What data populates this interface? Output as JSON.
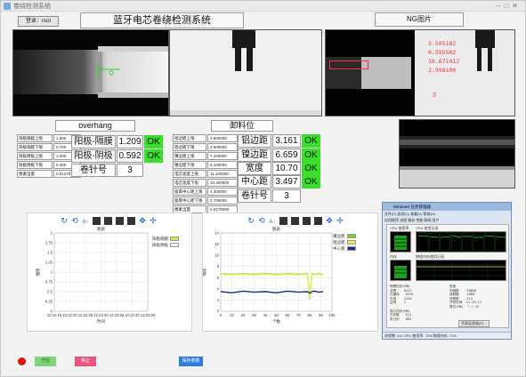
{
  "window": {
    "title": "卷绕检测系统"
  },
  "header": {
    "login_label": "登录：root",
    "main_title": "蓝牙电芯卷绕检测系统",
    "ng_title": "NG图片"
  },
  "ng_image": {
    "readings": [
      "3.505182",
      "0.595502",
      "10.671412",
      "2.998100"
    ],
    "mark": "3"
  },
  "overhang": {
    "title": "overhang",
    "params": [
      {
        "label": "阳极隔膜上限",
        "value": "1.500"
      },
      {
        "label": "阳极隔膜下限",
        "value": "0.700"
      },
      {
        "label": "阳极阴极上限",
        "value": "1.000"
      },
      {
        "label": "阳极阴极下限",
        "value": "0.300"
      },
      {
        "label": "像素当量",
        "value": "0.01278"
      }
    ],
    "measures": [
      {
        "label": "阳极-隔膜",
        "value": "1.209",
        "status": "OK"
      },
      {
        "label": "阳极-阴极",
        "value": "0.592",
        "status": "OK"
      }
    ],
    "reel_label": "卷针号",
    "reel_value": "3"
  },
  "unload": {
    "title": "卸料位",
    "params": [
      {
        "label": "铝边距上限",
        "value": "3.600000"
      },
      {
        "label": "铝边距下限",
        "value": "2.600000"
      },
      {
        "label": "镍边距上限",
        "value": "7.100000"
      },
      {
        "label": "镍边距下限",
        "value": "6.100000"
      },
      {
        "label": "电芯宽度上限",
        "value": "11.100000"
      },
      {
        "label": "电芯宽度下限",
        "value": "10.300000"
      },
      {
        "label": "极耳中心距上限",
        "value": "4.300000"
      },
      {
        "label": "极耳中心距下限",
        "value": "2.700000"
      },
      {
        "label": "像素当量",
        "value": "0.0178060"
      }
    ],
    "measures": [
      {
        "label": "铝边距",
        "value": "3.161",
        "status": "OK"
      },
      {
        "label": "镍边距",
        "value": "6.659",
        "status": "OK"
      },
      {
        "label": "宽度",
        "value": "10.70",
        "status": "OK"
      },
      {
        "label": "中心距",
        "value": "3.497",
        "status": "OK"
      }
    ],
    "reel_label": "卷针号",
    "reel_value": "3"
  },
  "chart_data": [
    {
      "type": "line",
      "title": "图表",
      "xlabel": "时间",
      "ylabel": "幅值",
      "ylim": [
        0,
        2
      ],
      "y_ticks": [
        "2",
        "1.75",
        "1.5",
        "1.25",
        "1",
        "0.75",
        "0.5",
        "0.25",
        "0"
      ],
      "x_ticks": [
        "12:22:15",
        "12:22:20",
        "12:22:25",
        "12:22:30",
        "12:22:35",
        "12:22:40",
        "12:22:50"
      ],
      "series": [
        {
          "name": "阳极隔膜",
          "values": [],
          "color": "#d6e54a"
        },
        {
          "name": "阳极阴极",
          "values": [],
          "color": "#f0f0f0"
        }
      ],
      "grid": true,
      "legend": "top-right"
    },
    {
      "type": "line",
      "title": "图表",
      "xlabel": "个数",
      "ylabel": "幅值",
      "ylim": [
        0,
        14
      ],
      "xlim": [
        0,
        100
      ],
      "y_ticks": [
        "14",
        "12",
        "10",
        "8",
        "6",
        "4",
        "2",
        "0"
      ],
      "x_ticks": [
        "0",
        "10",
        "20",
        "30",
        "40",
        "50",
        "60",
        "70",
        "80",
        "90",
        "100"
      ],
      "series": [
        {
          "name": "镍边距",
          "color": "#7ed12a",
          "x": [
            0,
            10,
            20,
            30,
            40,
            50,
            60,
            70,
            78,
            80,
            82,
            84,
            88,
            92
          ],
          "values": [
            6.7,
            6.6,
            6.7,
            6.6,
            6.7,
            6.6,
            6.7,
            6.6,
            6.7,
            2.1,
            6.7,
            6.6,
            6.7,
            6.6
          ]
        },
        {
          "name": "铝边距",
          "color": "#e6f05a",
          "x": [
            0,
            10,
            20,
            30,
            40,
            50,
            60,
            70,
            78,
            80,
            82,
            84,
            88,
            92
          ],
          "values": [
            6.6,
            6.5,
            6.6,
            6.5,
            6.6,
            6.5,
            6.6,
            6.5,
            6.6,
            2.1,
            6.6,
            6.5,
            6.6,
            6.5
          ]
        },
        {
          "name": "中心距",
          "color": "#1a2a8c",
          "x": [
            0,
            10,
            20,
            30,
            40,
            50,
            60,
            70,
            78,
            80,
            82,
            84,
            88,
            92
          ],
          "values": [
            3.5,
            3.3,
            3.6,
            3.4,
            3.5,
            3.3,
            3.6,
            3.4,
            3.5,
            3.2,
            3.5,
            3.6,
            3.4,
            3.5
          ]
        }
      ],
      "grid": true,
      "legend": "top-right"
    }
  ],
  "task_manager": {
    "title": "Windows 任务管理器",
    "menu": "文件(F)  选项(O)  查看(V)  帮助(H)",
    "tabs": "应用程序  进程  服务  性能  联网  用户",
    "cpu_label": "CPU 使用率",
    "cpu_history_label": "CPU 使用记录",
    "mem_label": "内存",
    "mem_history_label": "物理内存使用记录",
    "stats_left": "物理内存(MB)\n总数    8117\n已缓存   1070\n可用    2245\n空闲    1\n\n核心内存(MB)\n分页数   913\n未分页   180",
    "stats_right": "系统\n句柄数    28826\n线程数    1068\n进程数    114\n开机时间  11:15:17\n提交(MB)  7 / 15",
    "resmon_label": "资源监视器(R)...",
    "status": "进程数: 114      CPU 使用率: 72%      物理内存: 71%"
  },
  "footer": {
    "start_label": "开始",
    "stop_label": "停止",
    "save_label": "保存参数"
  }
}
